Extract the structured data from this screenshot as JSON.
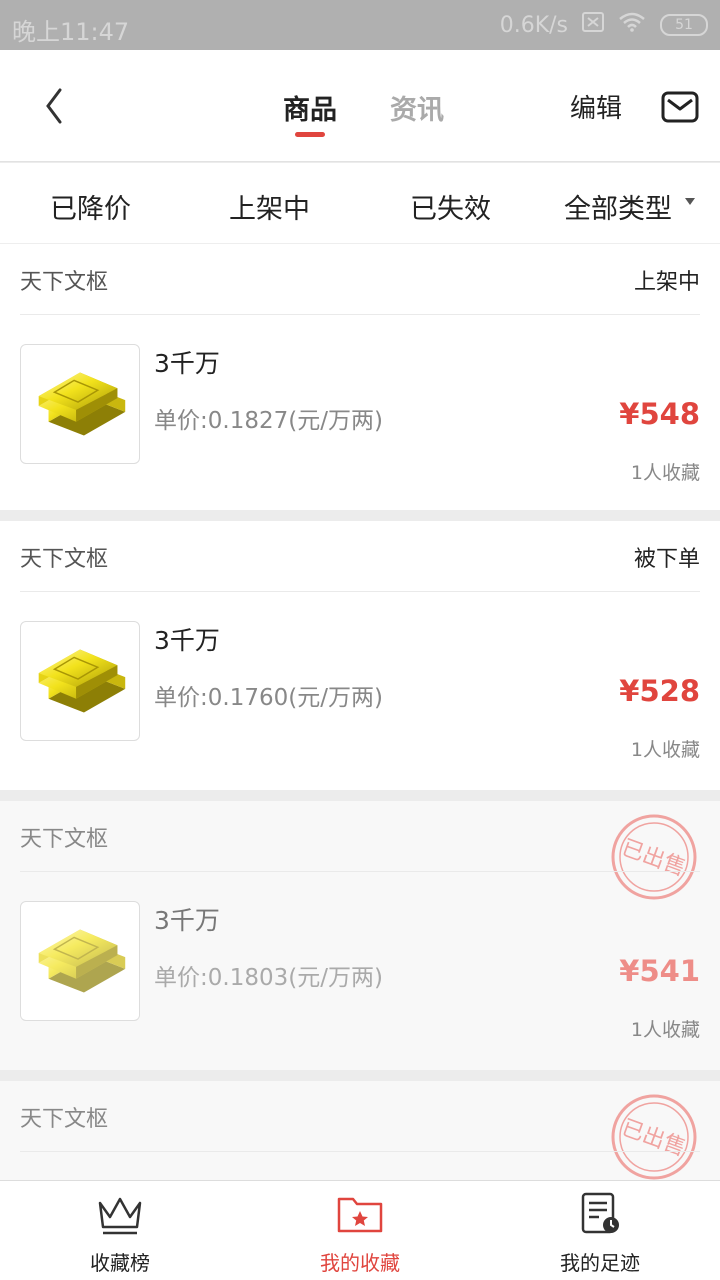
{
  "status_bar": {
    "time": "晚上11:47",
    "network_speed": "0.6K/s",
    "battery": "51"
  },
  "header": {
    "tabs": [
      {
        "label": "商品",
        "active": true
      },
      {
        "label": "资讯",
        "active": false
      }
    ],
    "edit_label": "编辑",
    "icons": {
      "back": "chevron-left-icon",
      "mail": "mail-icon"
    },
    "accent_color": "#e0453e"
  },
  "filters": [
    "已降价",
    "上架中",
    "已失效",
    "全部类型"
  ],
  "items": [
    {
      "shop": "天下文枢",
      "status": "上架中",
      "title": "3千万",
      "unit_price": "单价:0.1827(元/万两)",
      "price": "¥548",
      "favorites": "1人收藏",
      "sold": false
    },
    {
      "shop": "天下文枢",
      "status": "被下单",
      "title": "3千万",
      "unit_price": "单价:0.1760(元/万两)",
      "price": "¥528",
      "favorites": "1人收藏",
      "sold": false
    },
    {
      "shop": "天下文枢",
      "status": "",
      "stamp": "已出售",
      "title": "3千万",
      "unit_price": "单价:0.1803(元/万两)",
      "price": "¥541",
      "favorites": "1人收藏",
      "sold": true
    },
    {
      "shop": "天下文枢",
      "status": "",
      "stamp": "已出售",
      "sold": true
    }
  ],
  "bottom_nav": [
    {
      "label": "收藏榜",
      "icon": "crown-icon",
      "active": false
    },
    {
      "label": "我的收藏",
      "icon": "star-folder-icon",
      "active": true
    },
    {
      "label": "我的足迹",
      "icon": "history-document-icon",
      "active": false
    }
  ]
}
